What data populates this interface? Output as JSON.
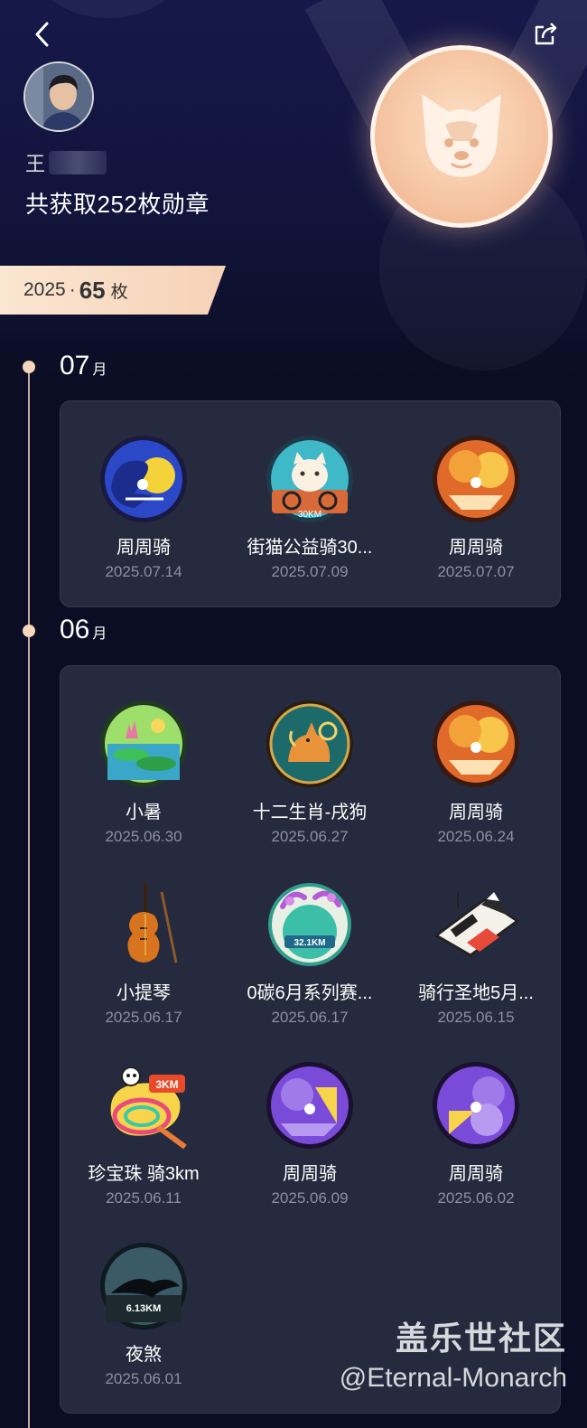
{
  "header": {
    "back_icon": "chevron-left-icon",
    "share_icon": "share-icon",
    "username_visible": "王",
    "total_text": "共获取252枚勋章"
  },
  "year_summary": {
    "year": "2025",
    "separator": "·",
    "count": "65",
    "unit": "枚"
  },
  "months": [
    {
      "month": "07",
      "unit": "月",
      "badges": [
        {
          "name": "周周骑",
          "date": "2025.07.14",
          "icon": "weekly-ride-blue-medal-icon"
        },
        {
          "name": "街猫公益骑30...",
          "date": "2025.07.09",
          "icon": "street-cat-30km-medal-icon"
        },
        {
          "name": "周周骑",
          "date": "2025.07.07",
          "icon": "weekly-ride-orange-medal-icon"
        }
      ]
    },
    {
      "month": "06",
      "unit": "月",
      "badges": [
        {
          "name": "小暑",
          "date": "2025.06.30",
          "icon": "xiaoshu-medal-icon"
        },
        {
          "name": "十二生肖-戌狗",
          "date": "2025.06.27",
          "icon": "zodiac-dog-medal-icon"
        },
        {
          "name": "周周骑",
          "date": "2025.06.24",
          "icon": "weekly-ride-orange-medal-icon"
        },
        {
          "name": "小提琴",
          "date": "2025.06.17",
          "icon": "violin-medal-icon"
        },
        {
          "name": "0碳6月系列赛...",
          "date": "2025.06.17",
          "icon": "zero-carbon-32km-medal-icon"
        },
        {
          "name": "骑行圣地5月...",
          "date": "2025.06.15",
          "icon": "cycling-holy-land-medal-icon"
        },
        {
          "name": "珍宝珠 骑3km",
          "date": "2025.06.11",
          "icon": "chupa-chups-3km-medal-icon"
        },
        {
          "name": "周周骑",
          "date": "2025.06.09",
          "icon": "weekly-ride-purple-medal-icon"
        },
        {
          "name": "周周骑",
          "date": "2025.06.02",
          "icon": "weekly-ride-purple-medal-icon"
        },
        {
          "name": "夜煞",
          "date": "2025.06.01",
          "icon": "night-fury-6km-medal-icon"
        }
      ]
    }
  ],
  "medal_texts": {
    "cat_km": "30KM",
    "carbon_km": "32.1KM",
    "candy_km": "3KM",
    "fury_km": "6.13KM"
  },
  "watermark": {
    "line1": "盖乐世社区",
    "line2": "@Eternal-Monarch"
  },
  "colors": {
    "background": "#0b0d24",
    "card": "#262a3e",
    "accent_peach": "#f6d2b6",
    "date_gray": "#8d90a4"
  }
}
